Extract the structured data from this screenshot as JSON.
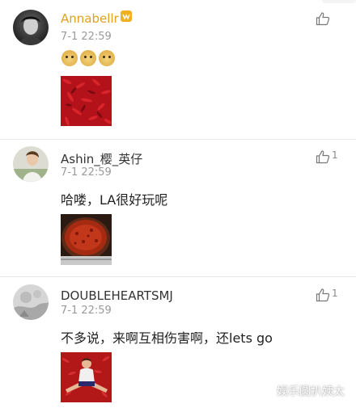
{
  "comments": [
    {
      "username": "Annabellr",
      "timestamp": "7-1 22:59",
      "like_count": "",
      "emojis": [
        "doge",
        "doge",
        "doge"
      ],
      "text": "",
      "image": "red chili peppers"
    },
    {
      "username": "Ashin_樱_英仔",
      "timestamp": "7-1 22:59",
      "like_count": "1",
      "text": "哈喽，LA很好玩呢",
      "image": "hot pot with red chili oil"
    },
    {
      "username": "DOUBLEHEARTSMJ",
      "timestamp": "7-1 22:59",
      "like_count": "1",
      "text": "不多说，来啊互相伤害啊，还lets go",
      "image": "person sitting in chili peppers"
    }
  ],
  "watermark": {
    "text": "娱乐圆扒姨太",
    "icon": "wechat-icon"
  },
  "colors": {
    "vip_username": "#e0a020",
    "username": "#333333",
    "timestamp": "#9a9a9a",
    "divider": "#e8e8e8"
  }
}
